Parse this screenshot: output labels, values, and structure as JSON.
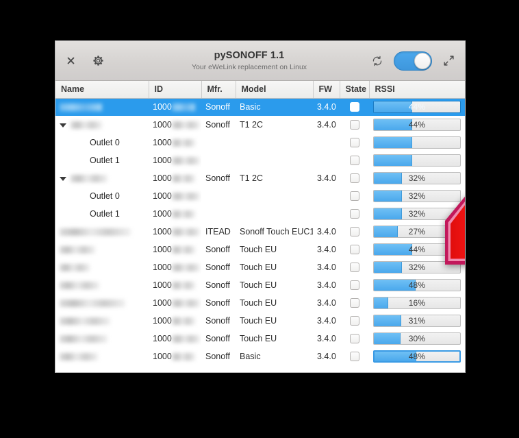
{
  "window": {
    "title": "pySONOFF 1.1",
    "subtitle": "Your eWeLink replacement on Linux",
    "close_label": "×",
    "icons": {
      "close": "close-icon",
      "settings": "gear-icon",
      "refresh": "refresh-icon",
      "toggle": "power-toggle",
      "expand": "expand-icon"
    },
    "accent_color": "#2b9bec",
    "titlebar_color": "#d6d3d1"
  },
  "table": {
    "columns": [
      "Name",
      "ID",
      "Mfr.",
      "Model",
      "FW",
      "State",
      "RSSI"
    ],
    "rows": [
      {
        "name": "",
        "name_redacted": true,
        "indent": 0,
        "expander": "none",
        "id_prefix": "1000",
        "id_redacted": true,
        "mfr": "Sonoff",
        "model": "Basic",
        "fw": "3.4.0",
        "state": false,
        "rssi": 44,
        "rssi_label": "44%",
        "selected": true,
        "bar_focused": false
      },
      {
        "name": "",
        "name_redacted": true,
        "indent": 0,
        "expander": "expanded",
        "id_prefix": "1000",
        "id_redacted": true,
        "mfr": "Sonoff",
        "model": "T1 2C",
        "fw": "3.4.0",
        "state": false,
        "rssi": 44,
        "rssi_label": "44%",
        "selected": false,
        "bar_focused": false
      },
      {
        "name": "Outlet 0",
        "name_redacted": false,
        "indent": 1,
        "expander": "none",
        "id_prefix": "1000",
        "id_redacted": true,
        "mfr": "",
        "model": "",
        "fw": "",
        "state": false,
        "rssi": 44,
        "rssi_label": "",
        "selected": false,
        "bar_focused": false
      },
      {
        "name": "Outlet 1",
        "name_redacted": false,
        "indent": 1,
        "expander": "none",
        "id_prefix": "1000",
        "id_redacted": true,
        "mfr": "",
        "model": "",
        "fw": "",
        "state": false,
        "rssi": 44,
        "rssi_label": "",
        "selected": false,
        "bar_focused": false
      },
      {
        "name": "",
        "name_redacted": true,
        "indent": 0,
        "expander": "expanded",
        "id_prefix": "1000",
        "id_redacted": true,
        "mfr": "Sonoff",
        "model": "T1 2C",
        "fw": "3.4.0",
        "state": false,
        "rssi": 32,
        "rssi_label": "32%",
        "selected": false,
        "bar_focused": false
      },
      {
        "name": "Outlet 0",
        "name_redacted": false,
        "indent": 1,
        "expander": "none",
        "id_prefix": "1000",
        "id_redacted": true,
        "mfr": "",
        "model": "",
        "fw": "",
        "state": false,
        "rssi": 32,
        "rssi_label": "32%",
        "selected": false,
        "bar_focused": false
      },
      {
        "name": "Outlet 1",
        "name_redacted": false,
        "indent": 1,
        "expander": "none",
        "id_prefix": "1000",
        "id_redacted": true,
        "mfr": "",
        "model": "",
        "fw": "",
        "state": false,
        "rssi": 32,
        "rssi_label": "32%",
        "selected": false,
        "bar_focused": false
      },
      {
        "name": "",
        "name_redacted": true,
        "indent": 0,
        "expander": "none",
        "id_prefix": "1000",
        "id_redacted": true,
        "mfr": "ITEAD",
        "model": "Sonoff Touch EUC1",
        "fw": "3.4.0",
        "state": false,
        "rssi": 27,
        "rssi_label": "27%",
        "selected": false,
        "bar_focused": false
      },
      {
        "name": "",
        "name_redacted": true,
        "indent": 0,
        "expander": "none",
        "id_prefix": "1000",
        "id_redacted": true,
        "mfr": "Sonoff",
        "model": "Touch EU",
        "fw": "3.4.0",
        "state": false,
        "rssi": 44,
        "rssi_label": "44%",
        "selected": false,
        "bar_focused": false
      },
      {
        "name": "",
        "name_redacted": true,
        "indent": 0,
        "expander": "none",
        "id_prefix": "1000",
        "id_redacted": true,
        "mfr": "Sonoff",
        "model": "Touch EU",
        "fw": "3.4.0",
        "state": false,
        "rssi": 32,
        "rssi_label": "32%",
        "selected": false,
        "bar_focused": false
      },
      {
        "name": "",
        "name_redacted": true,
        "indent": 0,
        "expander": "none",
        "id_prefix": "1000",
        "id_redacted": true,
        "mfr": "Sonoff",
        "model": "Touch EU",
        "fw": "3.4.0",
        "state": false,
        "rssi": 48,
        "rssi_label": "48%",
        "selected": false,
        "bar_focused": false
      },
      {
        "name": "",
        "name_redacted": true,
        "indent": 0,
        "expander": "none",
        "id_prefix": "1000",
        "id_redacted": true,
        "mfr": "Sonoff",
        "model": "Touch EU",
        "fw": "3.4.0",
        "state": false,
        "rssi": 16,
        "rssi_label": "16%",
        "selected": false,
        "bar_focused": false
      },
      {
        "name": "",
        "name_redacted": true,
        "indent": 0,
        "expander": "none",
        "id_prefix": "1000",
        "id_redacted": true,
        "mfr": "Sonoff",
        "model": "Touch EU",
        "fw": "3.4.0",
        "state": false,
        "rssi": 31,
        "rssi_label": "31%",
        "selected": false,
        "bar_focused": false
      },
      {
        "name": "",
        "name_redacted": true,
        "indent": 0,
        "expander": "none",
        "id_prefix": "1000",
        "id_redacted": true,
        "mfr": "Sonoff",
        "model": "Touch EU",
        "fw": "3.4.0",
        "state": false,
        "rssi": 30,
        "rssi_label": "30%",
        "selected": false,
        "bar_focused": false
      },
      {
        "name": "",
        "name_redacted": true,
        "indent": 0,
        "expander": "none",
        "id_prefix": "1000",
        "id_redacted": true,
        "mfr": "Sonoff",
        "model": "Basic",
        "fw": "3.4.0",
        "state": false,
        "rssi": 48,
        "rssi_label": "48%",
        "selected": false,
        "bar_focused": true
      }
    ]
  },
  "overlay": {
    "cursor": "red-arrow-cursor",
    "cursor_fill": "#ee1111",
    "cursor_border": "#c2185b"
  }
}
